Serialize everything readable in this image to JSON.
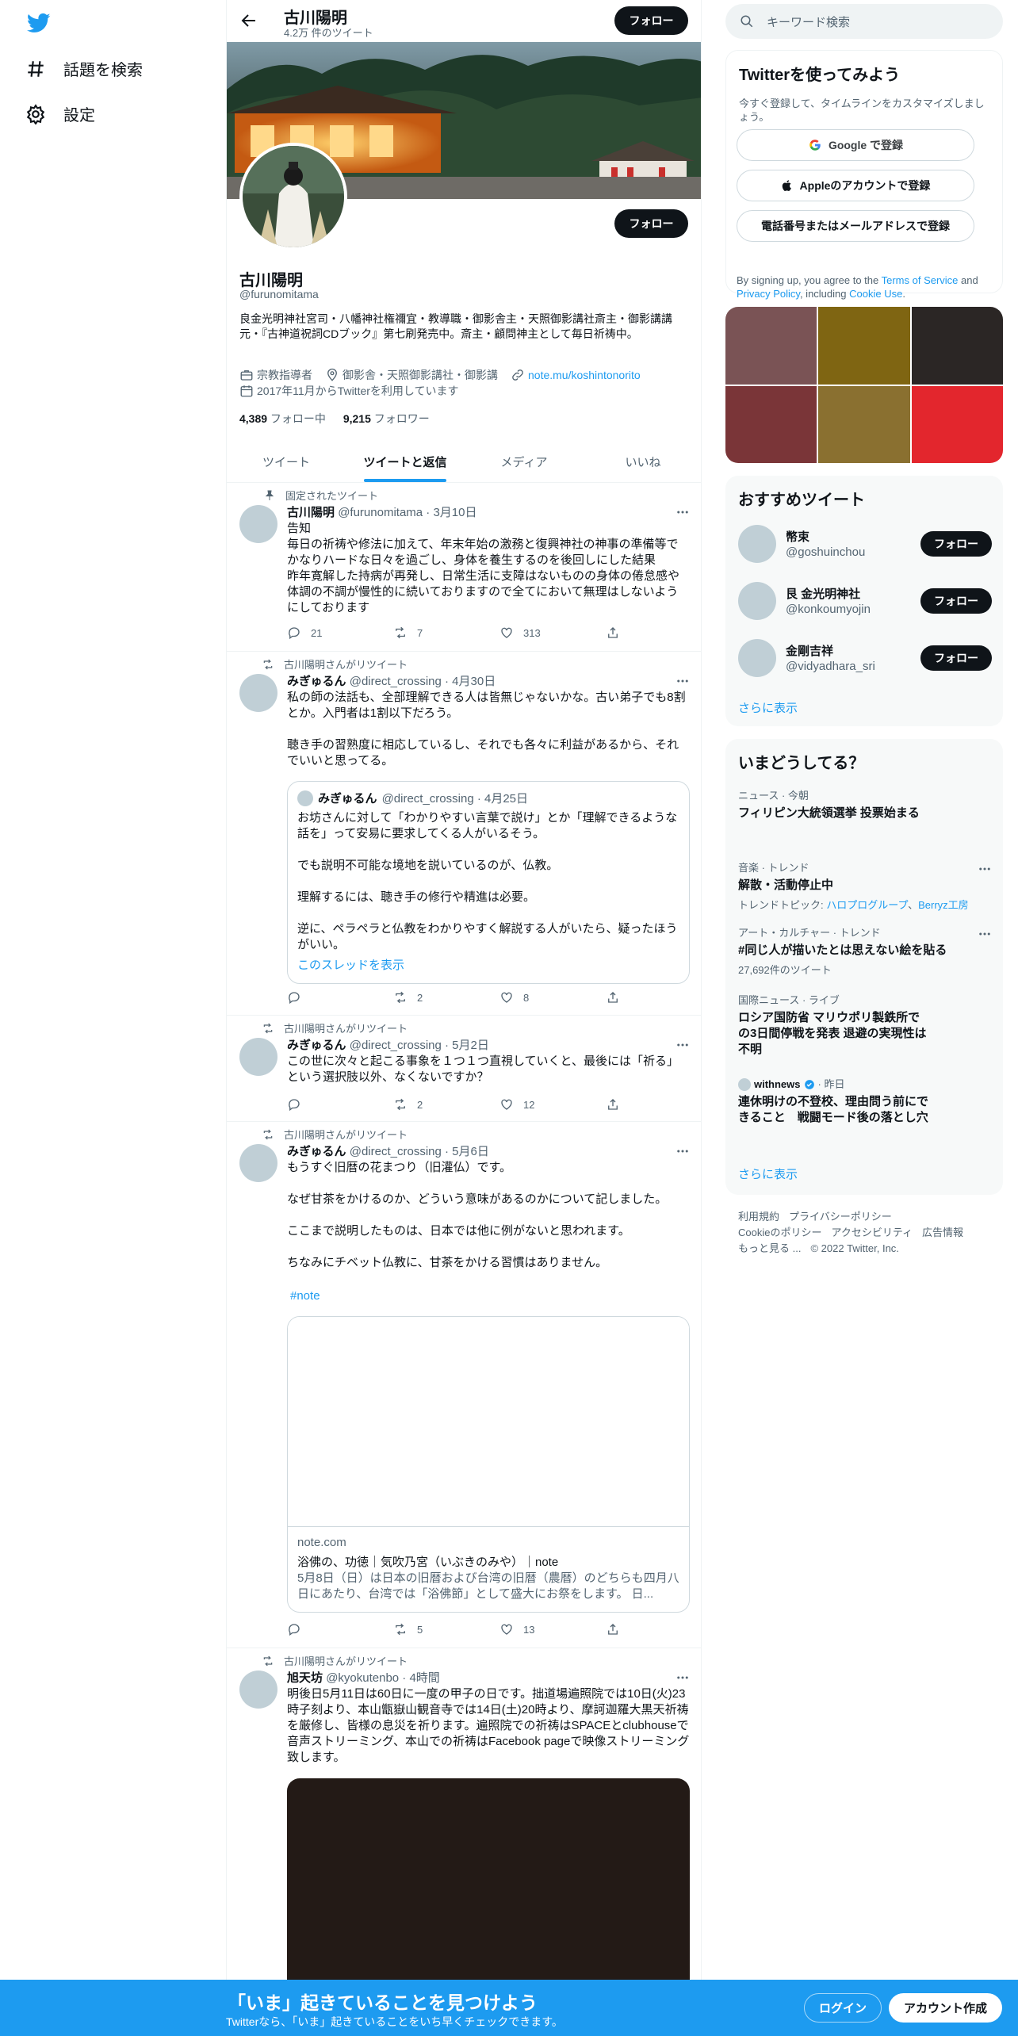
{
  "nav": {
    "explore_label": "話題を検索",
    "settings_label": "設定"
  },
  "header": {
    "title": "古川陽明",
    "tweet_count": "4.2万 件のツイート",
    "follow_label": "フォロー"
  },
  "profile": {
    "name": "古川陽明",
    "handle": "@furunomitama",
    "bio": "良金光明神社宮司・八幡神社権禰宜・教導職・御影舎主・天照御影講社斎主・御影講講元・『古神道祝詞CDブック』第七刷発売中。斎主・顧問神主として毎日祈祷中。",
    "category": "宗教指導者",
    "location": "御影舎・天照御影講社・御影講",
    "website": "note.mu/koshintonorito",
    "joined": "2017年11月からTwitterを利用しています",
    "following_count": "4,389",
    "following_label": " フォロー中",
    "followers_count": "9,215",
    "followers_label": " フォロワー",
    "follow_label": "フォロー"
  },
  "tabs": [
    "ツイート",
    "ツイートと返信",
    "メディア",
    "いいね"
  ],
  "tweets": [
    {
      "context": "固定されたツイート",
      "name": "古川陽明",
      "meta": "@furunomitama · 3月10日",
      "body": "告知\n毎日の祈祷や修法に加えて、年末年始の激務と復興神社の神事の準備等でかなりハードな日々を過ごし、身体を養生するのを後回しにした結果\n昨年寛解した持病が再発し、日常生活に支障はないものの身体の倦怠感や体調の不調が慢性的に続いておりますので全てにおいて無理はしないようにしております",
      "reply": "21",
      "retweet": "7",
      "like": "313"
    },
    {
      "context": "古川陽明さんがリツイート",
      "name": "みぎゅるん",
      "meta": "@direct_crossing · 4月30日",
      "body": "私の師の法話も、全部理解できる人は皆無じゃないかな。古い弟子でも8割とか。入門者は1割以下だろう。\n\n聴き手の習熟度に相応しているし、それでも各々に利益があるから、それでいいと思ってる。",
      "reply": "",
      "retweet": "2",
      "like": "8",
      "quote": {
        "name": "みぎゅるん",
        "meta": "@direct_crossing · 4月25日",
        "body": "お坊さんに対して「わかりやすい言葉で説け」とか「理解できるような話を」って安易に要求してくる人がいるそう。\n\nでも説明不可能な境地を説いているのが、仏教。\n\n理解するには、聴き手の修行や精進は必要。\n\n逆に、ペラペラと仏教をわかりやすく解説する人がいたら、疑ったほうがいい。",
        "thread_link": "このスレッドを表示"
      }
    },
    {
      "context": "古川陽明さんがリツイート",
      "name": "みぎゅるん",
      "meta": "@direct_crossing · 5月2日",
      "body": "この世に次々と起こる事象を１つ１つ直視していくと、最後には「祈る」という選択肢以外、なくないですか？",
      "reply": "",
      "retweet": "2",
      "like": "12"
    },
    {
      "context": "古川陽明さんがリツイート",
      "name": "みぎゅるん",
      "meta": "@direct_crossing · 5月6日",
      "body": "もうすぐ旧暦の花まつり（旧灌仏）です。\n\nなぜ甘茶をかけるのか、どういう意味があるのかについて記しました。\n\nここまで説明したものは、日本では他に例がないと思われます。\n\nちなみにチベット仏教に、甘茶をかける習慣はありません。",
      "hashtag": "#note",
      "reply": "",
      "retweet": "5",
      "like": "13",
      "card": {
        "domain": "note.com",
        "title": "浴佛の、功徳｜気吹乃宮（いぶきのみや）｜note",
        "desc": "5月8日（日）は日本の旧暦および台湾の旧暦（農暦）のどちらも四月八日にあたり、台湾では「浴佛節」として盛大にお祭をします。 日..."
      }
    },
    {
      "context": "古川陽明さんがリツイート",
      "name": "旭天坊",
      "meta": "@kyokutenbo · 4時間",
      "body": "明後日5月11日は60日に一度の甲子の日です。拙道場遍照院では10日(火)23時子刻より、本山甑嶽山観音寺では14日(土)20時より、摩訶迦羅大黒天祈祷を厳修し、皆様の息災を祈ります。遍照院での祈祷はSPACEとclubhouseで音声ストリーミング、本山での祈祷はFacebook pageで映像ストリーミング致します。"
    }
  ],
  "search": {
    "placeholder": "キーワード検索"
  },
  "signup": {
    "title": "Twitterを使ってみよう",
    "subtitle": "今すぐ登録して、タイムラインをカスタマイズしましょう。",
    "google": "Google で登録",
    "apple": "Appleのアカウントで登録",
    "phone": "電話番号またはメールアドレスで登録",
    "legal_1": "By signing up, you agree to the ",
    "terms": "Terms of Service",
    "legal_2": " and ",
    "privacy": "Privacy Policy",
    "legal_3": ", including ",
    "cookie": "Cookie Use",
    "legal_4": "."
  },
  "photos": [
    "#7a5355",
    "#7f6512",
    "#2b2625",
    "#7a3538",
    "#8a7030",
    "#e3262d"
  ],
  "who_to_follow": {
    "title": "おすすめツイート",
    "items": [
      {
        "name": "幣束",
        "handle": "@goshuinchou"
      },
      {
        "name": "艮 金光明神社",
        "handle": "@konkoumyojin"
      },
      {
        "name": "金剛吉祥",
        "handle": "@vidyadhara_sri"
      }
    ],
    "follow_label": "フォロー",
    "show_more": "さらに表示"
  },
  "trends": {
    "title": "いまどうしてる？",
    "items": [
      {
        "category": "ニュース · 今朝",
        "title": "フィリピン大統領選挙 投票始まる"
      },
      {
        "category": "音楽 · トレンド",
        "title": "解散・活動停止中",
        "extra_label": "トレンドトピック: ",
        "extra_1": "ハロプログループ",
        "extra_sep": "、",
        "extra_2": "Berryz工房"
      },
      {
        "category": "アート・カルチャー · トレンド",
        "title": "#同じ人が描いたとは思えない絵を貼る",
        "extra": "27,692件のツイート"
      },
      {
        "category": "国際ニュース · ライブ",
        "title": "ロシア国防省 マリウポリ製鉄所での3日間停戦を発表 退避の実現性は不明"
      },
      {
        "source": "withnews",
        "time": " · 昨日",
        "title": "連休明けの不登校、理由問う前にできること　戦闘モード後の落とし穴"
      }
    ],
    "show_more": "さらに表示"
  },
  "footer": [
    "利用規約",
    "プライバシーポリシー",
    "Cookieのポリシー",
    "アクセシビリティ",
    "広告情報",
    "もっと見る ...",
    "© 2022 Twitter, Inc."
  ],
  "bottom": {
    "title": "「いま」起きていることを見つけよう",
    "subtitle": "Twitterなら、「いま」起きていることをいち早くチェックできます。",
    "login": "ログイン",
    "signup": "アカウント作成"
  }
}
